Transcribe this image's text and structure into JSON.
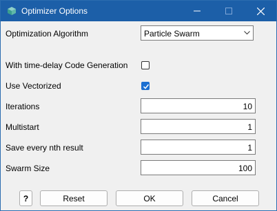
{
  "window": {
    "title": "Optimizer Options",
    "accent": "#1c5fa8"
  },
  "titlebar_icons": [
    "app-cube-icon",
    "minimize-icon",
    "maximize-icon",
    "close-icon"
  ],
  "form": {
    "algorithm_label": "Optimization Algorithm",
    "algorithm_value": "Particle Swarm",
    "timedelay_label": "With time-delay Code Generation",
    "timedelay_checked": false,
    "vectorized_label": "Use Vectorized",
    "vectorized_checked": true,
    "iterations_label": "Iterations",
    "iterations_value": "10",
    "multistart_label": "Multistart",
    "multistart_value": "1",
    "save_nth_label": "Save every nth result",
    "save_nth_value": "1",
    "swarm_size_label": "Swarm Size",
    "swarm_size_value": "100"
  },
  "buttons": {
    "help_label": "?",
    "reset_label": "Reset",
    "ok_label": "OK",
    "cancel_label": "Cancel"
  }
}
